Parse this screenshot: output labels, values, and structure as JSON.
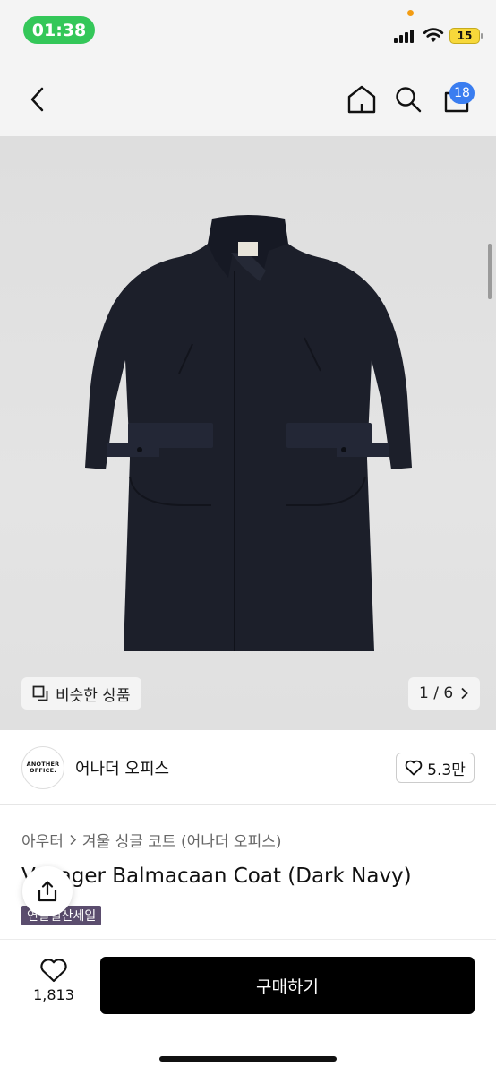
{
  "status_bar": {
    "time": "01:38",
    "battery": "15"
  },
  "nav": {
    "cart_count": "18",
    "icons": [
      "back-icon",
      "home-icon",
      "search-icon",
      "cart-icon"
    ]
  },
  "image": {
    "similar_label": "비슷한 상품",
    "page_indicator": "1 / 6"
  },
  "brand": {
    "logo_line1": "ANOTHER",
    "logo_line2": "OFFICE.",
    "name": "어나더 오피스",
    "likes": "5.3만"
  },
  "product": {
    "category_1": "아우터",
    "category_2": "겨울 싱글 코트 (어나더 오피스)",
    "title": "Voyager Balmacaan Coat (Dark Navy)",
    "badge": "연말결산세일"
  },
  "bottom": {
    "wish_count": "1,813",
    "buy_label": "구매하기"
  },
  "colors": {
    "badge_blue": "#3a7df0",
    "time_green": "#34c759",
    "sale_badge": "#5b4d6e",
    "coat_navy": "#1c1f2a"
  }
}
